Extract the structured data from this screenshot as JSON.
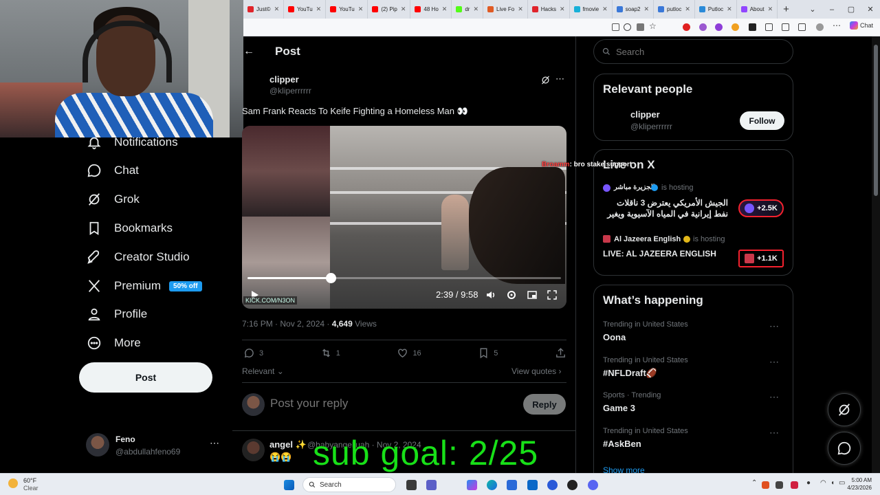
{
  "browser": {
    "tabs": [
      {
        "label": "Just©",
        "color": "#e0242b"
      },
      {
        "label": "YouTu",
        "color": "#ff0000"
      },
      {
        "label": "YouTu",
        "color": "#ff0000"
      },
      {
        "label": "(2) Pip",
        "color": "#ff0000"
      },
      {
        "label": "48 Ho",
        "color": "#ff0000"
      },
      {
        "label": "dr",
        "color": "#53fc18"
      },
      {
        "label": "Live Fo",
        "color": "#e05b24"
      },
      {
        "label": "Hacks",
        "color": "#e0242b"
      },
      {
        "label": "fmovie",
        "color": "#18b0d8"
      },
      {
        "label": "soap2",
        "color": "#3a78d8"
      },
      {
        "label": "putloc",
        "color": "#3a78d8"
      },
      {
        "label": "Putloc",
        "color": "#2a8ad8"
      },
      {
        "label": "About",
        "color": "#9146ff"
      }
    ],
    "chat_chip": "Chat"
  },
  "nav": {
    "notifications": "Notifications",
    "chat": "Chat",
    "grok": "Grok",
    "bookmarks": "Bookmarks",
    "creator_studio": "Creator Studio",
    "premium": "Premium",
    "premium_badge": "50% off",
    "profile": "Profile",
    "more": "More",
    "post_button": "Post",
    "account_name": "Feno",
    "account_handle": "@abdullahfeno69"
  },
  "post": {
    "header": "Post",
    "author_name": "clipper",
    "author_handle": "@kliperrrrrr",
    "text": "Sam Frank Reacts To Keife Fighting a Homeless Man 👀",
    "video_time": "2:39 / 9:58",
    "video_progress": 0.266,
    "kick_tag": "KICK.COM/N3ON",
    "timestamp": "7:16 PM · Nov 2, 2024 ·",
    "views_count": "4,649",
    "views_label": "Views",
    "replies": "3",
    "reposts": "1",
    "likes": "16",
    "bookmarks": "5",
    "sort_label": "Relevant",
    "view_quotes": "View quotes",
    "reply_placeholder": "Post your reply",
    "reply_button": "Reply",
    "reply_author": "angel ✨",
    "reply_handle": "@babyangeljuah · Nov 2, 2024",
    "reply_text": "😭😭"
  },
  "sidebar": {
    "search_placeholder": "Search",
    "relevant_title": "Relevant people",
    "person_name": "clipper",
    "person_handle": "@kliperrrrrr",
    "follow_label": "Follow",
    "live_title": "Live on X",
    "live": [
      {
        "host": "الجزيرة مباشر",
        "status": "is hosting",
        "title": "الجيش الأمريكي يعترض 3 ناقلات نفط إيرانية في المياه الآسيوية ويغير",
        "listeners": "+2.5K"
      },
      {
        "host": "Al Jazeera English",
        "status": "is hosting",
        "title": "LIVE: AL JAZEERA ENGLISH",
        "listeners": "+1.1K"
      }
    ],
    "happening_title": "What’s happening",
    "trends": [
      {
        "meta": "Trending in United States",
        "name": "Oona"
      },
      {
        "meta": "Trending in United States",
        "name": "#NFLDraft🏈"
      },
      {
        "meta": "Sports · Trending",
        "name": "Game 3"
      },
      {
        "meta": "Trending in United States",
        "name": "#AskBen"
      }
    ],
    "show_more": "Show more"
  },
  "overlay": {
    "chat_user": "Broamm",
    "chat_message": ": bro stake support",
    "sub_goal": "sub goal: 2/25"
  },
  "taskbar": {
    "weather_temp": "60°F",
    "weather_desc": "Clear",
    "search_label": "Search",
    "time": "5:00 AM",
    "date": "4/23/2026"
  }
}
